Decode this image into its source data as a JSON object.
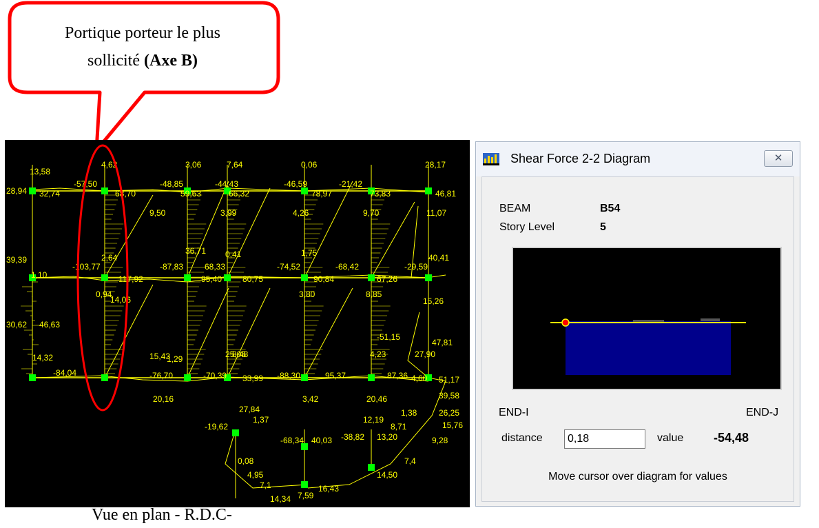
{
  "callout": {
    "line1": "Portique porteur le plus",
    "line2_prefix": "sollicité ",
    "line2_bold": "(Axe B)",
    "color": "#ff0000"
  },
  "caption": "Vue en plan - R.D.C-",
  "plan": {
    "background": "#000000",
    "line_color": "#ffff00",
    "node_color": "#00ff00",
    "labels": [
      "28,94",
      "13,58",
      "32,74",
      "-57,50",
      "4,62",
      "68,70",
      "-48,85",
      "3,06",
      "59,63",
      "-44,43",
      "7,64",
      "66,32",
      "-46,59",
      "0,06",
      "78,97",
      "-21,42",
      "73,83",
      "28,17",
      "46,81",
      "9,50",
      "3,99",
      "4,26",
      "9,70",
      "11,07",
      "39,39",
      "1,10",
      "-103,77",
      "2,64",
      "117,92",
      "-87,83",
      "36,71",
      "68,33",
      "95,40",
      "0,41",
      "80,75",
      "-74,52",
      "1,75",
      "90,84",
      "-68,42",
      "67,26",
      "-29,59",
      "40,41",
      "0,94",
      "14,06",
      "3,80",
      "8,85",
      "15,26",
      "30,62",
      "46,63",
      "-51,15",
      "47,81",
      "14,32",
      "-84,04",
      "15,43",
      "-76,70",
      "1,29",
      "-70,39",
      "25,06",
      "8,48",
      "33,99",
      "-88,30",
      "95,37",
      "4,23",
      "87,36",
      "27,90",
      "51,17",
      "20,16",
      "3,42",
      "20,46",
      "4,60",
      "39,58",
      "26,25",
      "15,76",
      "9,28",
      "-19,62",
      "27,84",
      "1,37",
      "-68,34",
      "40,03",
      "-38,82",
      "12,19",
      "13,20",
      "8,71",
      "1,38",
      "14,50",
      "0,08",
      "4,95",
      "7,1",
      "14,34",
      "7,59",
      "16,43",
      "7,4"
    ]
  },
  "dialog": {
    "title": "Shear Force 2-2 Diagram",
    "close_label": "✕",
    "beam_label": "BEAM",
    "beam_value": "B54",
    "story_label": "Story Level",
    "story_value": "5",
    "end_i": "END-I",
    "end_j": "END-J",
    "distance_label": "distance",
    "distance_value": "0,18",
    "value_label": "value",
    "value_value": "-54,48",
    "hint": "Move cursor over diagram for values",
    "diagram_fill": "#00008b",
    "diagram_line": "#ffff00",
    "marker_color": "#ff0000"
  }
}
